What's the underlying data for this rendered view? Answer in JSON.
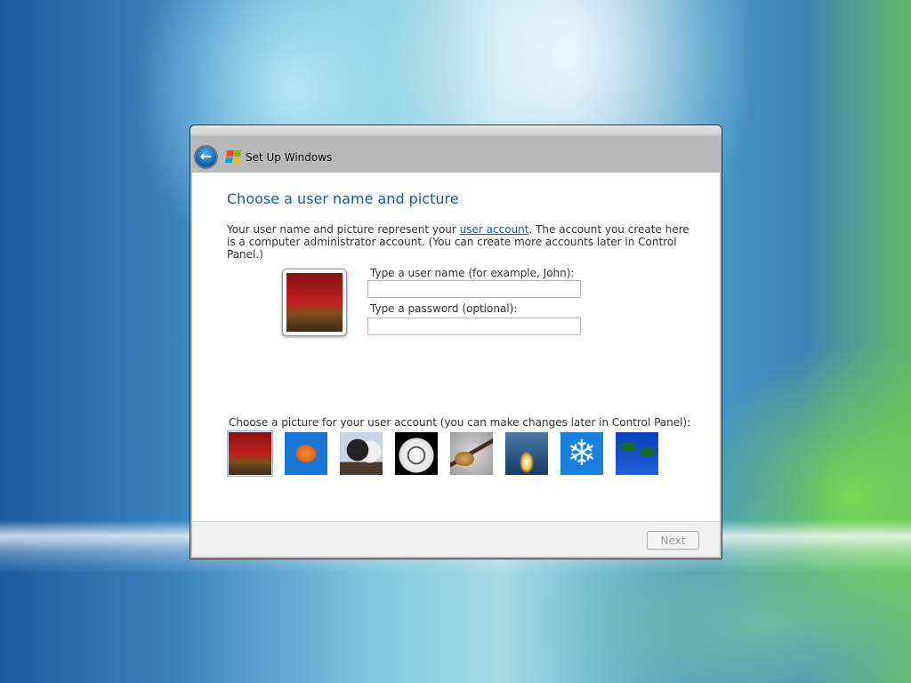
{
  "window": {
    "title": "Set Up Windows"
  },
  "page": {
    "heading": "Choose a user name and picture",
    "description_before": "Your user name and picture represent your ",
    "description_link": "user account",
    "description_after": ". The account you create here is a computer administrator account. (You can create more accounts later in Control Panel.)"
  },
  "form": {
    "username_label": "Type a user name (for example, John):",
    "username_value": "",
    "password_label": "Type a password (optional):",
    "password_value": ""
  },
  "pictures": {
    "label": "Choose a picture for your user account (you can make changes later in Control Panel):",
    "items": [
      "chess",
      "fish",
      "horses",
      "soccer-ball",
      "guitar",
      "space-shuttle",
      "snowflake",
      "palm-trees"
    ],
    "selected": "chess"
  },
  "footer": {
    "next_label": "Next"
  }
}
